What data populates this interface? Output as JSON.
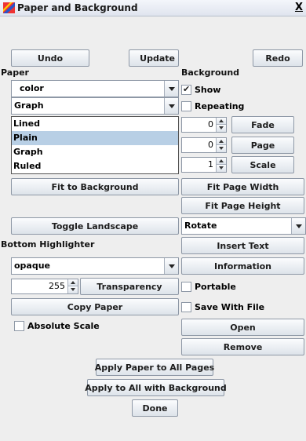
{
  "window": {
    "title": "Paper and Background",
    "close_label": "X"
  },
  "toolbar": {
    "undo": "Undo",
    "update": "Update",
    "redo": "Redo"
  },
  "paper": {
    "section_label": "Paper",
    "color_combo": "color",
    "style_combo": "Graph",
    "style_options": [
      "Lined",
      "Plain",
      "Graph",
      "Ruled"
    ],
    "highlighted_option": "Plain",
    "fit_to_background": "Fit to Background",
    "toggle_landscape": "Toggle Landscape",
    "bottom_highlighter_label": "Bottom Highlighter",
    "highlighter_combo": "opaque",
    "transparency_value": "255",
    "transparency_button": "Transparency",
    "copy_paper": "Copy Paper",
    "absolute_scale_label": "Absolute Scale",
    "absolute_scale_checked": false
  },
  "background": {
    "section_label": "Background",
    "show_label": "Show",
    "show_checked": true,
    "repeating_label": "Repeating",
    "repeating_checked": false,
    "fade_value": "0",
    "fade_button": "Fade",
    "page_value": "0",
    "page_button": "Page",
    "scale_value": "1",
    "scale_button": "Scale",
    "fit_page_width": "Fit Page Width",
    "fit_page_height": "Fit Page Height",
    "rotate_combo": "Rotate",
    "insert_text": "Insert Text",
    "information": "Information",
    "portable_label": "Portable",
    "portable_checked": false,
    "save_with_file_label": "Save With File",
    "save_with_file_checked": false,
    "open": "Open",
    "remove": "Remove"
  },
  "footer": {
    "apply_all_pages": "Apply Paper to All Pages",
    "apply_all_background": "Apply to All with Background",
    "done": "Done"
  }
}
